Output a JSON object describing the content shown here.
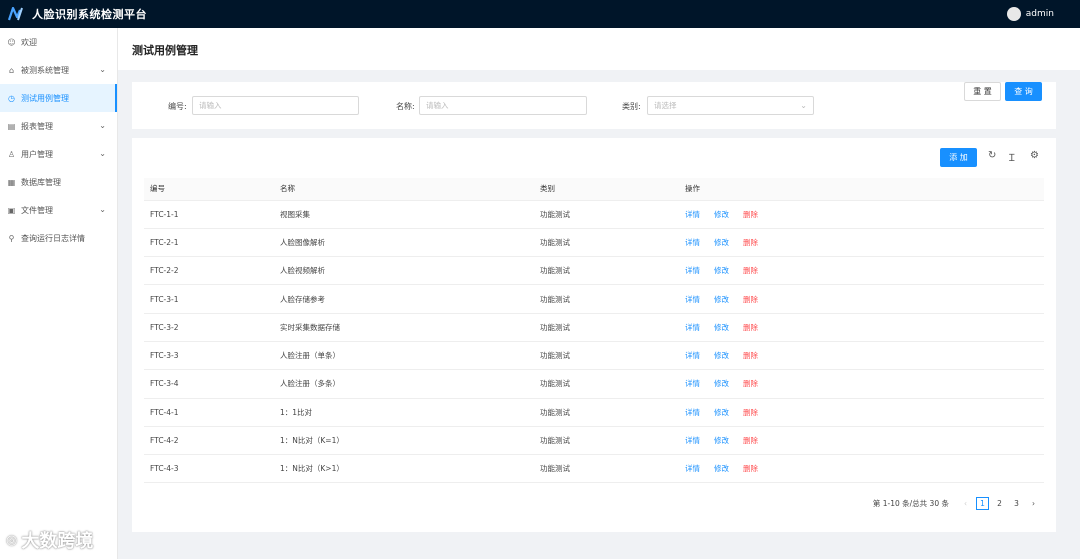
{
  "app": {
    "title": "人脸识别系统检测平台",
    "user": "admin"
  },
  "sidebar": {
    "items": [
      {
        "label": "欢迎",
        "icon": "smile-icon"
      },
      {
        "label": "被测系统管理",
        "icon": "home-icon"
      },
      {
        "label": "测试用例管理",
        "icon": "clock-icon"
      },
      {
        "label": "报表管理",
        "icon": "file-icon"
      },
      {
        "label": "用户管理",
        "icon": "user-icon"
      },
      {
        "label": "数据库管理",
        "icon": "database-icon"
      },
      {
        "label": "文件管理",
        "icon": "folder-icon"
      },
      {
        "label": "查询运行日志详情",
        "icon": "search-icon"
      }
    ]
  },
  "page": {
    "title": "测试用例管理"
  },
  "search": {
    "code_label": "编号:",
    "code_placeholder": "请输入",
    "name_label": "名称:",
    "name_placeholder": "请输入",
    "type_label": "类别:",
    "type_placeholder": "请选择",
    "reset": "重 置",
    "query": "查 询"
  },
  "toolbar": {
    "add": "添 加"
  },
  "table": {
    "headers": [
      "编号",
      "名称",
      "类别",
      "操作"
    ],
    "actions": {
      "view": "详情",
      "edit": "修改",
      "delete": "删除"
    },
    "rows": [
      {
        "code": "FTC-1-1",
        "name": "视图采集",
        "type": "功能测试"
      },
      {
        "code": "FTC-2-1",
        "name": "人脸图像解析",
        "type": "功能测试"
      },
      {
        "code": "FTC-2-2",
        "name": "人脸视频解析",
        "type": "功能测试"
      },
      {
        "code": "FTC-3-1",
        "name": "人脸存储参考",
        "type": "功能测试"
      },
      {
        "code": "FTC-3-2",
        "name": "实时采集数据存储",
        "type": "功能测试"
      },
      {
        "code": "FTC-3-3",
        "name": "人脸注册（单条）",
        "type": "功能测试"
      },
      {
        "code": "FTC-3-4",
        "name": "人脸注册（多条）",
        "type": "功能测试"
      },
      {
        "code": "FTC-4-1",
        "name": "1：1比对",
        "type": "功能测试"
      },
      {
        "code": "FTC-4-2",
        "name": "1：N比对（K=1）",
        "type": "功能测试"
      },
      {
        "code": "FTC-4-3",
        "name": "1：N比对（K>1）",
        "type": "功能测试"
      }
    ]
  },
  "pagination": {
    "summary": "第 1-10 条/总共 30 条",
    "pages": [
      "1",
      "2",
      "3"
    ],
    "current": "1"
  },
  "watermark": {
    "text": "大数跨境"
  },
  "colors": {
    "primary": "#1890ff",
    "danger": "#ff4d4f",
    "header_bg": "#001529"
  }
}
